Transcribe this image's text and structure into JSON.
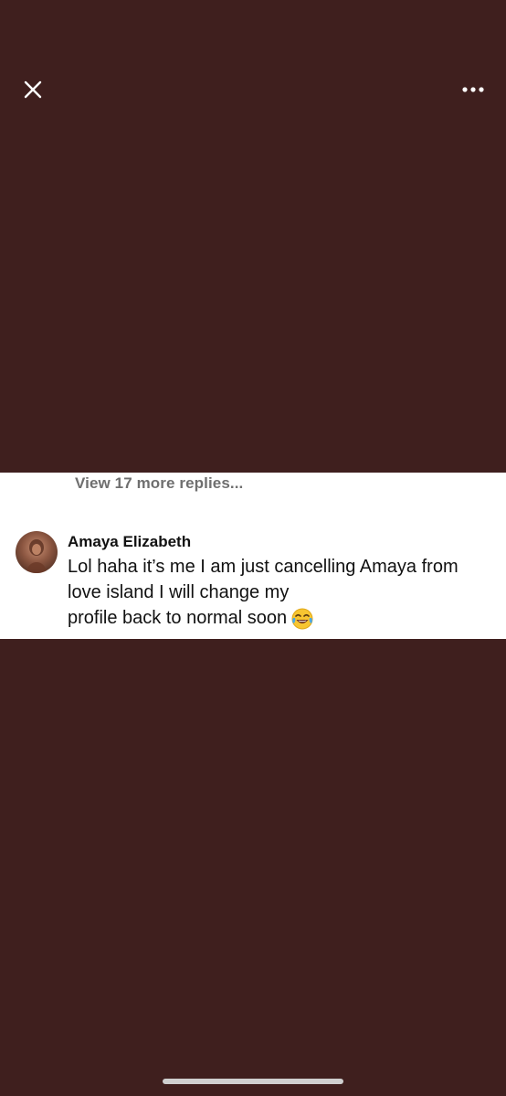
{
  "topbar": {
    "close_icon": "close-icon",
    "more_icon": "more-horizontal-icon"
  },
  "comment": {
    "view_replies": "View 17 more replies...",
    "author": "Amaya Elizabeth",
    "lines": [
      "Lol haha it’s me I am just cancelling Amaya from",
      "love island I will change my",
      "profile back to normal soon"
    ],
    "emoji_icon": "face-with-tears-of-joy-icon"
  },
  "colors": {
    "background": "#3f1f1e",
    "card": "#ffffff",
    "muted_text": "#6f6f6f",
    "text": "#111111"
  }
}
